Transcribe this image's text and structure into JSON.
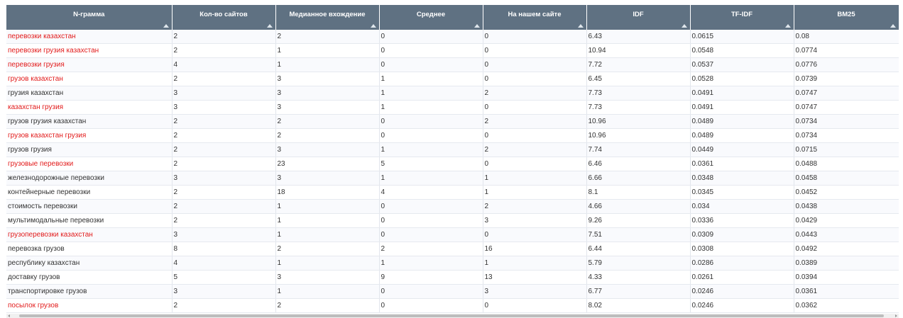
{
  "table": {
    "columns": [
      "N-грамма",
      "Кол-во сайтов",
      "Медианное вхождение",
      "Среднее",
      "На нашем сайте",
      "IDF",
      "TF-IDF",
      "BM25"
    ],
    "highlight_color": "#e21b1b",
    "rows": [
      {
        "ngram": "перевозки казахстан",
        "highlight": true,
        "sites": "2",
        "median": "2",
        "mean": "0",
        "ours": "0",
        "idf": "6.43",
        "tfidf": "0.0615",
        "bm25": "0.08"
      },
      {
        "ngram": "перевозки грузия казахстан",
        "highlight": true,
        "sites": "2",
        "median": "1",
        "mean": "0",
        "ours": "0",
        "idf": "10.94",
        "tfidf": "0.0548",
        "bm25": "0.0774"
      },
      {
        "ngram": "перевозки грузия",
        "highlight": true,
        "sites": "4",
        "median": "1",
        "mean": "0",
        "ours": "0",
        "idf": "7.72",
        "tfidf": "0.0537",
        "bm25": "0.0776"
      },
      {
        "ngram": "грузов казахстан",
        "highlight": true,
        "sites": "2",
        "median": "3",
        "mean": "1",
        "ours": "0",
        "idf": "6.45",
        "tfidf": "0.0528",
        "bm25": "0.0739"
      },
      {
        "ngram": "грузия казахстан",
        "highlight": false,
        "sites": "3",
        "median": "3",
        "mean": "1",
        "ours": "2",
        "idf": "7.73",
        "tfidf": "0.0491",
        "bm25": "0.0747"
      },
      {
        "ngram": "казахстан грузия",
        "highlight": true,
        "sites": "3",
        "median": "3",
        "mean": "1",
        "ours": "0",
        "idf": "7.73",
        "tfidf": "0.0491",
        "bm25": "0.0747"
      },
      {
        "ngram": "грузов грузия казахстан",
        "highlight": false,
        "sites": "2",
        "median": "2",
        "mean": "0",
        "ours": "2",
        "idf": "10.96",
        "tfidf": "0.0489",
        "bm25": "0.0734"
      },
      {
        "ngram": "грузов казахстан грузия",
        "highlight": true,
        "sites": "2",
        "median": "2",
        "mean": "0",
        "ours": "0",
        "idf": "10.96",
        "tfidf": "0.0489",
        "bm25": "0.0734"
      },
      {
        "ngram": "грузов грузия",
        "highlight": false,
        "sites": "2",
        "median": "3",
        "mean": "1",
        "ours": "2",
        "idf": "7.74",
        "tfidf": "0.0449",
        "bm25": "0.0715"
      },
      {
        "ngram": "грузовые перевозки",
        "highlight": true,
        "sites": "2",
        "median": "23",
        "mean": "5",
        "ours": "0",
        "idf": "6.46",
        "tfidf": "0.0361",
        "bm25": "0.0488"
      },
      {
        "ngram": "железнодорожные перевозки",
        "highlight": false,
        "sites": "3",
        "median": "3",
        "mean": "1",
        "ours": "1",
        "idf": "6.66",
        "tfidf": "0.0348",
        "bm25": "0.0458"
      },
      {
        "ngram": "контейнерные перевозки",
        "highlight": false,
        "sites": "2",
        "median": "18",
        "mean": "4",
        "ours": "1",
        "idf": "8.1",
        "tfidf": "0.0345",
        "bm25": "0.0452"
      },
      {
        "ngram": "стоимость перевозки",
        "highlight": false,
        "sites": "2",
        "median": "1",
        "mean": "0",
        "ours": "2",
        "idf": "4.66",
        "tfidf": "0.034",
        "bm25": "0.0438"
      },
      {
        "ngram": "мультимодальные перевозки",
        "highlight": false,
        "sites": "2",
        "median": "1",
        "mean": "0",
        "ours": "3",
        "idf": "9.26",
        "tfidf": "0.0336",
        "bm25": "0.0429"
      },
      {
        "ngram": "грузоперевозки казахстан",
        "highlight": true,
        "sites": "3",
        "median": "1",
        "mean": "0",
        "ours": "0",
        "idf": "7.51",
        "tfidf": "0.0309",
        "bm25": "0.0443"
      },
      {
        "ngram": "перевозка грузов",
        "highlight": false,
        "sites": "8",
        "median": "2",
        "mean": "2",
        "ours": "16",
        "idf": "6.44",
        "tfidf": "0.0308",
        "bm25": "0.0492"
      },
      {
        "ngram": "республику казахстан",
        "highlight": false,
        "sites": "4",
        "median": "1",
        "mean": "1",
        "ours": "1",
        "idf": "5.79",
        "tfidf": "0.0286",
        "bm25": "0.0389"
      },
      {
        "ngram": "доставку грузов",
        "highlight": false,
        "sites": "5",
        "median": "3",
        "mean": "9",
        "ours": "13",
        "idf": "4.33",
        "tfidf": "0.0261",
        "bm25": "0.0394"
      },
      {
        "ngram": "транспортировке грузов",
        "highlight": false,
        "sites": "3",
        "median": "1",
        "mean": "0",
        "ours": "3",
        "idf": "6.77",
        "tfidf": "0.0246",
        "bm25": "0.0361"
      },
      {
        "ngram": "посылок грузов",
        "highlight": true,
        "sites": "2",
        "median": "2",
        "mean": "0",
        "ours": "0",
        "idf": "8.02",
        "tfidf": "0.0246",
        "bm25": "0.0362"
      }
    ]
  }
}
